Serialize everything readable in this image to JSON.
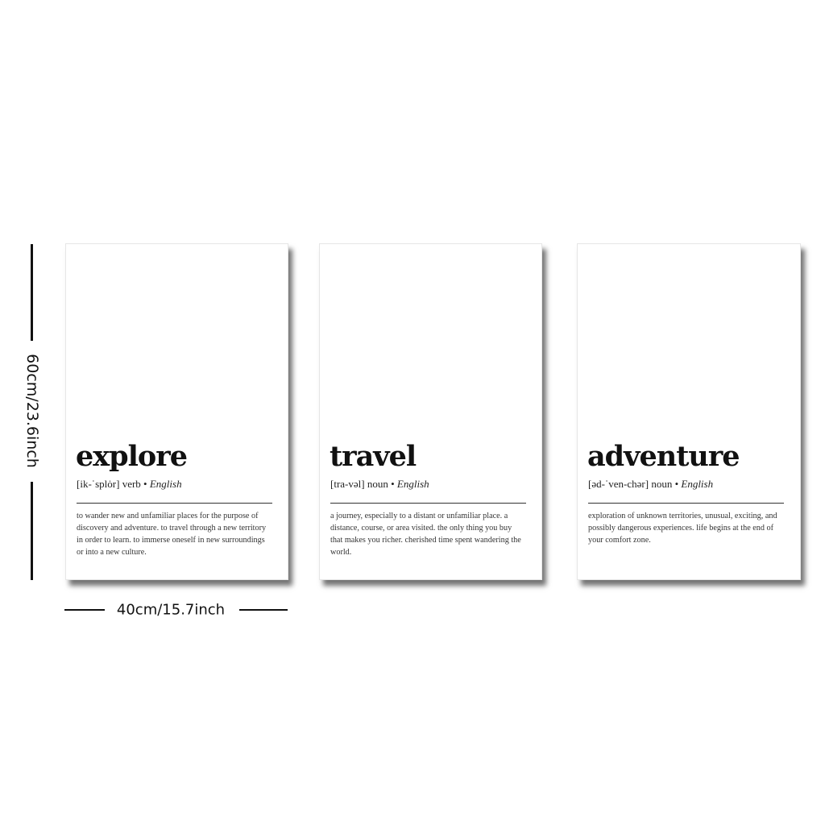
{
  "dimensions": {
    "height_label": "60cm/23.6inch",
    "width_label": "40cm/15.7inch"
  },
  "posters": [
    {
      "word": "explore",
      "pronunciation": "[ik-ˈsplȯr]",
      "part_of_speech": "verb",
      "bullet": "•",
      "language": "English",
      "definition": "to wander new and unfamiliar places for the purpose of discovery and adventure. to travel through a new territory in order to learn. to immerse oneself in new surroundings or into a new culture."
    },
    {
      "word": "travel",
      "pronunciation": "[tra-vəl]",
      "part_of_speech": "noun",
      "bullet": "•",
      "language": "English",
      "definition": "a journey, especially to a distant or unfamiliar place. a distance, course, or area visited. the only thing you buy that makes you richer. cherished time spent wandering the world."
    },
    {
      "word": "adventure",
      "pronunciation": "[əd-ˈven-chər]",
      "part_of_speech": "noun",
      "bullet": "•",
      "language": "English",
      "definition": "exploration of unknown territories, unusual, exciting, and possibly dangerous experiences. life begins at the end of your comfort zone."
    }
  ]
}
